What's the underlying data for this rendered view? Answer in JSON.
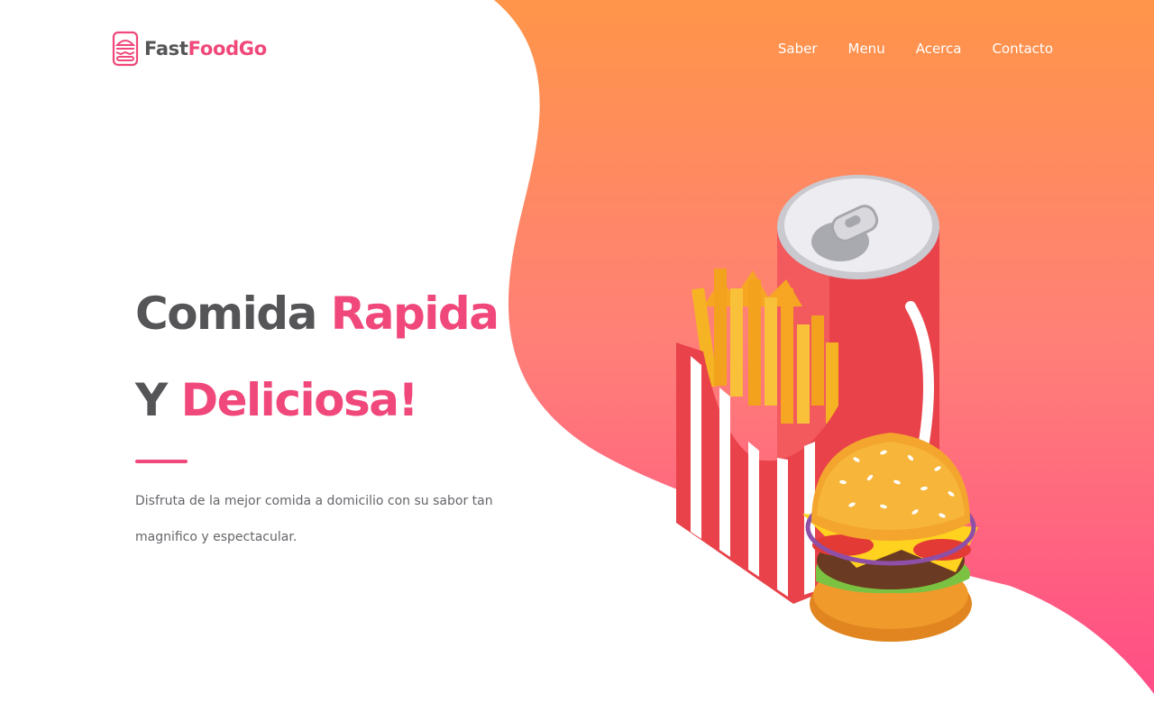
{
  "brand": {
    "name_part1": "Fast",
    "name_part2": "FoodGo",
    "icon": "burger-icon"
  },
  "nav": {
    "items": [
      "Saber",
      "Menu",
      "Acerca",
      "Contacto"
    ]
  },
  "hero": {
    "title_line1_plain": "Comida ",
    "title_line1_accent": "Rapida",
    "title_line2_plain": "Y ",
    "title_line2_accent": "Deliciosa!",
    "description": "Disfruta de la mejor comida a domicilio con su sabor tan magnifico y espectacular."
  },
  "colors": {
    "accent": "#f0487a",
    "text_dark": "#555456",
    "gradient_top": "#ff9549",
    "gradient_bottom": "#ff4d86"
  }
}
